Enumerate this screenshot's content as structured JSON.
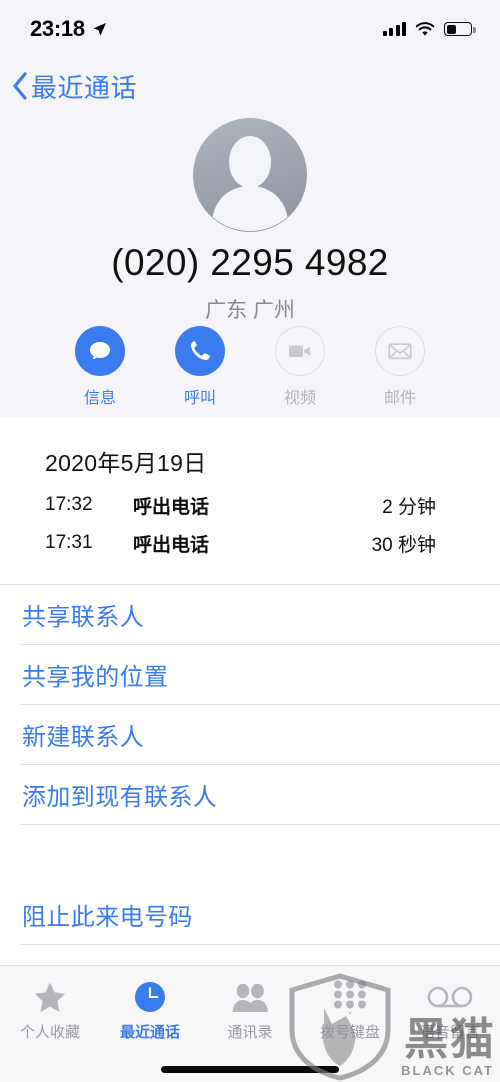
{
  "statusbar": {
    "time": "23:18",
    "location_icon": "location-arrow-icon",
    "signal_icon": "cellular-signal-icon",
    "wifi_icon": "wifi-icon",
    "battery_icon": "battery-icon",
    "battery_level": "36%"
  },
  "navbar": {
    "back_icon": "chevron-left-icon",
    "back_label": "最近通话"
  },
  "contact": {
    "avatar_icon": "person-placeholder-avatar",
    "phone_number": "(020) 2295 4982",
    "region": "广东 广州",
    "actions": [
      {
        "label": "信息",
        "icon": "message-bubble-icon",
        "enabled": true
      },
      {
        "label": "呼叫",
        "icon": "phone-handset-icon",
        "enabled": true
      },
      {
        "label": "视频",
        "icon": "video-camera-icon",
        "enabled": false
      },
      {
        "label": "邮件",
        "icon": "envelope-icon",
        "enabled": false
      }
    ]
  },
  "call_log": {
    "date": "2020年5月19日",
    "rows": [
      {
        "time": "17:32",
        "type": "呼出电话",
        "duration": "2 分钟"
      },
      {
        "time": "17:31",
        "type": "呼出电话",
        "duration": "30 秒钟"
      }
    ]
  },
  "actions_list": [
    {
      "label": "共享联系人"
    },
    {
      "label": "共享我的位置"
    },
    {
      "label": "新建联系人"
    },
    {
      "label": "添加到现有联系人"
    }
  ],
  "block_section": [
    {
      "label": "阻止此来电号码"
    }
  ],
  "tabbar": {
    "tabs": [
      {
        "label": "个人收藏",
        "icon": "star-icon",
        "active": false
      },
      {
        "label": "最近通话",
        "icon": "clock-icon",
        "active": true
      },
      {
        "label": "通讯录",
        "icon": "contacts-people-icon",
        "active": false
      },
      {
        "label": "拨号键盘",
        "icon": "dial-keypad-icon",
        "active": false
      },
      {
        "label": "语音留言",
        "icon": "voicemail-icon",
        "active": false
      }
    ],
    "home_indicator": "home-indicator-bar"
  },
  "watermark": {
    "cn": "黑猫",
    "en": "BLACK CAT",
    "shield_icon": "black-cat-shield-logo"
  },
  "colors": {
    "accent_blue": "#3b7bf0",
    "header_bg": "#f5f5f9",
    "disabled_gray": "#b4b4b9",
    "divider": "#e2e2e6"
  }
}
